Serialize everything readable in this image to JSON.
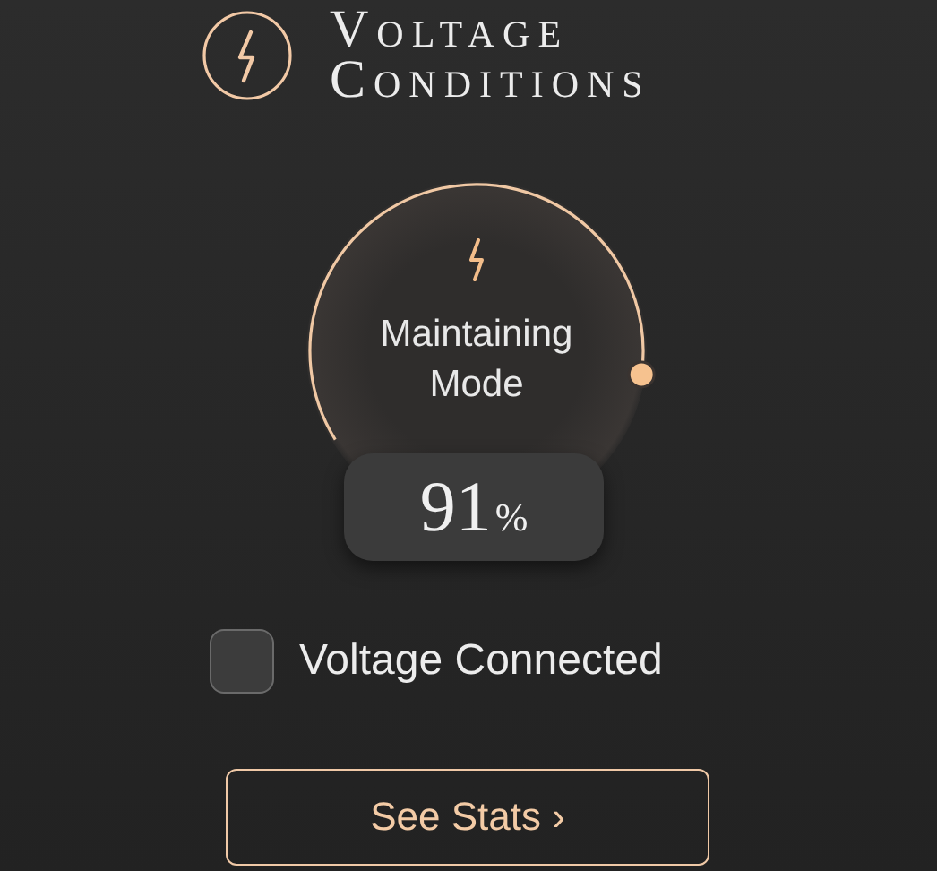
{
  "header": {
    "title_lines": [
      "Voltage",
      "Conditions"
    ]
  },
  "gauge": {
    "mode_lines": [
      "Maintaining",
      "Mode"
    ],
    "reading": "91",
    "unit": "%"
  },
  "checkbox": {
    "label": "Voltage Connected",
    "checked": false
  },
  "button": {
    "label": "See Stats",
    "chevron": "›"
  }
}
